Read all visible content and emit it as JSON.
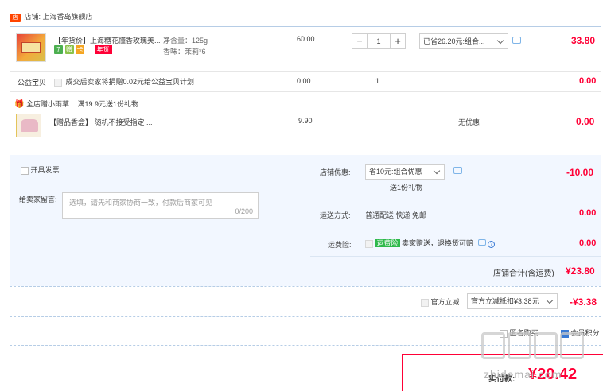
{
  "store": {
    "label": "店铺:",
    "name": "上海香岛旗舰店"
  },
  "item": {
    "title": "【年货价】上海糖花懂香玫瑰美...",
    "spec1": "净含量：125g",
    "spec2": "香味：茉莉*6",
    "unit_price": "60.00",
    "qty": "1",
    "discount_select": "已省26.20元:组合...",
    "subtotal": "33.80",
    "badge": "年货",
    "icon_tags": [
      "7",
      "赠",
      "卡"
    ]
  },
  "charity": {
    "label": "公益宝贝",
    "text": "成交后卖家将捐赠0.02元给公益宝贝计划",
    "price": "0.00",
    "qty": "1",
    "subtotal": "0.00"
  },
  "gift_promo": {
    "label": "全店赠小雨草",
    "desc": "满19.9元送1份礼物"
  },
  "gift_item": {
    "title": "【赠品香盒】 随机不接受指定 ...",
    "price": "9.90",
    "promo": "无优惠",
    "subtotal": "0.00"
  },
  "invoice_label": "开具发票",
  "message": {
    "label": "给卖家留言:",
    "placeholder": "选填，请先和商家协商一致，付款后商家可见",
    "count": "0/200"
  },
  "store_discount": {
    "label": "店铺优惠:",
    "select": "省10元:组合优惠",
    "note": "送1份礼物",
    "amount": "-10.00"
  },
  "shipping": {
    "label": "运送方式:",
    "value": "普通配送 快递 免邮",
    "amount": "0.00"
  },
  "insurance": {
    "label": "运费险:",
    "badge": "运费险",
    "text": "卖家赠送，退换货可赔",
    "amount": "0.00"
  },
  "store_total": {
    "label": "店铺合计(含运费)",
    "amount": "¥23.80"
  },
  "official_discount": {
    "label": "官方立减",
    "select": "官方立减抵扣¥3.38元",
    "amount": "-¥3.38"
  },
  "options": {
    "anonymous": "匿名购买",
    "member": "会员积分"
  },
  "pay": {
    "label": "实付款:",
    "amount": "¥20.42"
  },
  "watermark": "值 什么值得买 zhidemai.com",
  "colors": {
    "accent": "#ff0036",
    "link": "#3a7bd5",
    "insurance_green": "#2eb94b",
    "dash": "#b6cde6"
  }
}
